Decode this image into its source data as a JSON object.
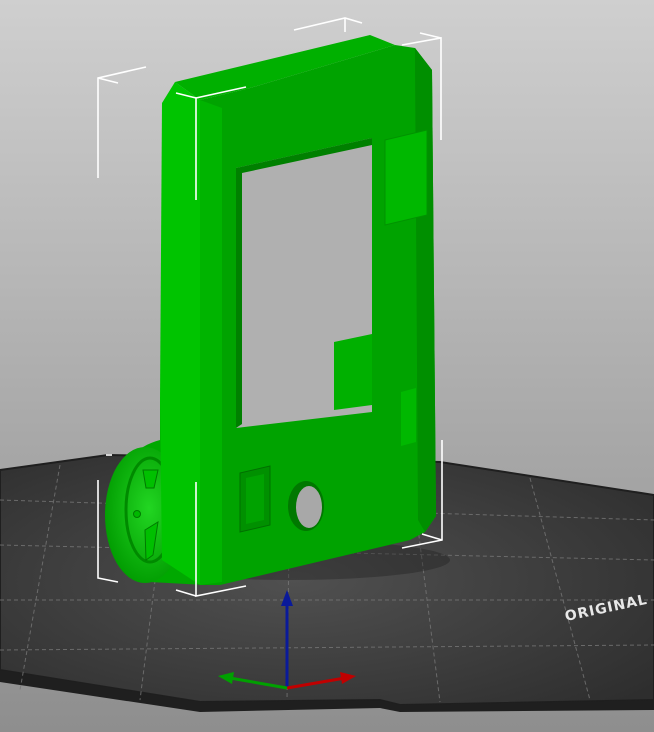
{
  "viewport": {
    "bed_label": "ORIGINAL"
  },
  "colors": {
    "background_top": "#cfcfcf",
    "background_bottom": "#8e8e8e",
    "bed_surface": "#3a3a3a",
    "bed_edge": "#1f1f1f",
    "bed_grid": "#6e6e6e",
    "model_face_light": "#00c800",
    "model_face_mid": "#00a000",
    "model_face_dark": "#008a00",
    "model_face_darker": "#006f00",
    "bounding_box": "#ffffff",
    "axis_x": "#c00000",
    "axis_y": "#00a000",
    "axis_z": "#0a1a9a"
  },
  "icons": {
    "axes": "axes-gizmo-icon"
  }
}
